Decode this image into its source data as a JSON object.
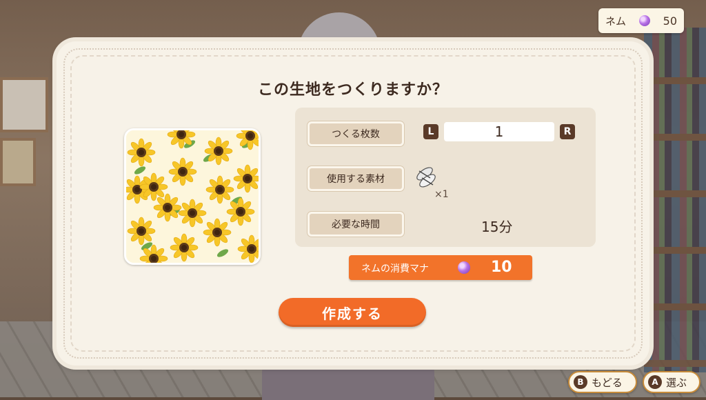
{
  "currency": {
    "label": "ネム",
    "icon": "purple-gem-icon",
    "value": "50"
  },
  "dialog": {
    "title": "この生地をつくりますか？",
    "fabric_pattern": "sunflower-pattern",
    "rows": {
      "quantity": {
        "label": "つくる枚数",
        "left_key": "L",
        "right_key": "R",
        "value": "1"
      },
      "material": {
        "label": "使用する素材",
        "icon": "sunflower-seeds-icon",
        "count": "×1"
      },
      "time": {
        "label": "必要な時間",
        "value": "15分"
      }
    },
    "mana": {
      "label": "ネムの消費マナ",
      "icon": "purple-gem-icon",
      "value": "10"
    },
    "create_button": "作成する"
  },
  "footer": {
    "back": {
      "key": "B",
      "label": "もどる"
    },
    "select": {
      "key": "A",
      "label": "選ぶ"
    }
  },
  "colors": {
    "accent_orange": "#f26b28",
    "panel_bg": "#f7f2e8",
    "label_bg": "#e3d3bd",
    "text_dark": "#3d2a20"
  }
}
